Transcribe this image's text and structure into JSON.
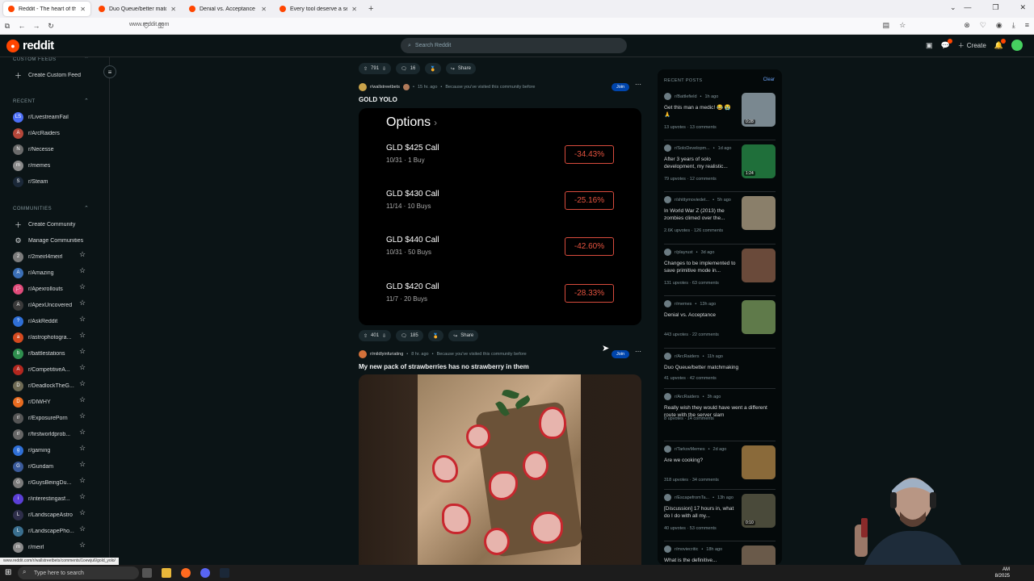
{
  "browser": {
    "tabs": [
      {
        "title": "Reddit - The heart of the internet",
        "active": true
      },
      {
        "title": "Duo Queue/better matchmaking",
        "active": false
      },
      {
        "title": "Denial vs. Acceptance : r/memes",
        "active": false
      },
      {
        "title": "Every tool deserve a second life",
        "active": false
      }
    ],
    "url": "www.reddit.com",
    "status_url": "www.reddit.com/r/wallstreetbets/comments/1oewju6/gold_yolo/"
  },
  "header": {
    "logo": "reddit",
    "search_placeholder": "Search Reddit",
    "create_label": "Create",
    "accent_color": "#ff4500"
  },
  "sidebar": {
    "custom_feeds_head": "CUSTOM FEEDS",
    "create_custom_feed": "Create Custom Feed",
    "recent_head": "RECENT",
    "recent": [
      {
        "label": "r/LivestreamFail",
        "color": "#4c6ef5",
        "glyph": "LS"
      },
      {
        "label": "r/ArcRaiders",
        "color": "#b5473a",
        "glyph": "A"
      },
      {
        "label": "r/Necesse",
        "color": "#6b6b6b",
        "glyph": "N"
      },
      {
        "label": "r/memes",
        "color": "#8a8a8a",
        "glyph": "m"
      },
      {
        "label": "r/Steam",
        "color": "#1b2838",
        "glyph": "S"
      }
    ],
    "communities_head": "COMMUNITIES",
    "create_community": "Create Community",
    "manage_communities": "Manage Communities",
    "communities": [
      {
        "label": "r/2meirl4meirl",
        "color": "#7c7c7c",
        "glyph": "2"
      },
      {
        "label": "r/Amazing",
        "color": "#3b6fb6",
        "glyph": "A"
      },
      {
        "label": "r/Apexrollouts",
        "color": "#e04b7a",
        "glyph": "🏳"
      },
      {
        "label": "r/ApexUncovered",
        "color": "#3a3a3a",
        "glyph": "A"
      },
      {
        "label": "r/AskReddit",
        "color": "#2f6fd6",
        "glyph": "?"
      },
      {
        "label": "r/astrophotogra...",
        "color": "#d44a1f",
        "glyph": "a"
      },
      {
        "label": "r/battlestations",
        "color": "#2f8f4e",
        "glyph": "b"
      },
      {
        "label": "r/CompetitiveA...",
        "color": "#b3271f",
        "glyph": "A"
      },
      {
        "label": "r/DeadlockTheG...",
        "color": "#6e6a54",
        "glyph": "D"
      },
      {
        "label": "r/DIWHY",
        "color": "#e86b1f",
        "glyph": "D"
      },
      {
        "label": "r/ExposurePorn",
        "color": "#555555",
        "glyph": "r/"
      },
      {
        "label": "r/firstworldprob...",
        "color": "#666666",
        "glyph": "r/"
      },
      {
        "label": "r/gaming",
        "color": "#2f6fd6",
        "glyph": "g"
      },
      {
        "label": "r/Gundam",
        "color": "#3a5a9a",
        "glyph": "G"
      },
      {
        "label": "r/GuysBeingDu...",
        "color": "#7b7b7b",
        "glyph": "G"
      },
      {
        "label": "r/interestingasf...",
        "color": "#5b3fd6",
        "glyph": "i"
      },
      {
        "label": "r/LandscapeAstro",
        "color": "#2e2e4a",
        "glyph": "L"
      },
      {
        "label": "r/LandscapePho...",
        "color": "#3a6f8f",
        "glyph": "L"
      },
      {
        "label": "r/meirl",
        "color": "#8a8a8a",
        "glyph": "m"
      }
    ]
  },
  "feed": {
    "post0": {
      "votes": "791",
      "comments": "16",
      "share": "Share"
    },
    "post1": {
      "subreddit": "r/wallstreetbets",
      "time": "15 hr. ago",
      "reason": "Because you've visited this community before",
      "join": "Join",
      "title": "GOLD YOLO",
      "image_title": "Options",
      "options": [
        {
          "name": "GLD $425 Call",
          "sub": "10/31 · 1 Buy",
          "pct": "-34.43%"
        },
        {
          "name": "GLD $430 Call",
          "sub": "11/14 · 10 Buys",
          "pct": "-25.16%"
        },
        {
          "name": "GLD $440 Call",
          "sub": "10/31 · 50 Buys",
          "pct": "-42.60%"
        },
        {
          "name": "GLD $420 Call",
          "sub": "11/7 · 20 Buys",
          "pct": "-28.33%"
        }
      ],
      "votes": "401",
      "comments": "185",
      "share": "Share"
    },
    "post2": {
      "subreddit": "r/mildlyinfuriating",
      "time": "8 hr. ago",
      "reason": "Because you've visited this community before",
      "join": "Join",
      "title": "My new pack of strawberries has no strawberry in them"
    }
  },
  "recent_posts": {
    "head": "RECENT POSTS",
    "clear": "Clear",
    "items": [
      {
        "community": "r/Battlefield",
        "time": "1h ago",
        "title": "Get this man a medic! 😂 😭 🙏",
        "stats": "13 upvotes · 13 comments",
        "thumb": "#7a8890",
        "duration": "0:28"
      },
      {
        "community": "r/SoloDevelopm...",
        "time": "1d ago",
        "title": "After 3 years of solo development, my realistic...",
        "stats": "79 upvotes · 12 comments",
        "thumb": "#1f6f3a",
        "duration": "1:24"
      },
      {
        "community": "r/shittymoviedet...",
        "time": "5h ago",
        "title": "In World War Z (2013) the zombies climed over the...",
        "stats": "2.6K upvotes · 126 comments",
        "thumb": "#8a7f6a",
        "duration": ""
      },
      {
        "community": "r/playrust",
        "time": "3d ago",
        "title": "Changes to be implemented to save primitive mode in...",
        "stats": "131 upvotes · 63 comments",
        "thumb": "#6a4a3a",
        "duration": ""
      },
      {
        "community": "r/memes",
        "time": "13h ago",
        "title": "Denial vs. Acceptance",
        "stats": "443 upvotes · 22 comments",
        "thumb": "#5f7a4a",
        "duration": ""
      },
      {
        "community": "r/ArcRaiders",
        "time": "11h ago",
        "title": "Duo Queue/better matchmaking",
        "stats": "41 upvotes · 42 comments",
        "thumb": "",
        "duration": ""
      },
      {
        "community": "r/ArcRaiders",
        "time": "3h ago",
        "title": "Really wish they would have went a different route with the server slam",
        "stats": "8 upvotes · 14 comments",
        "thumb": "",
        "duration": ""
      },
      {
        "community": "r/TarkovMemes",
        "time": "2d ago",
        "title": "Are we cooking?",
        "stats": "318 upvotes · 34 comments",
        "thumb": "#8a6a3a",
        "duration": ""
      },
      {
        "community": "r/EscapefromTa...",
        "time": "13h ago",
        "title": "[Discussion] 17 hours in, what do I do with all my...",
        "stats": "40 upvotes · 53 comments",
        "thumb": "#4a4a3a",
        "duration": "0:10"
      },
      {
        "community": "r/moviecritic",
        "time": "18h ago",
        "title": "What is the definitive...",
        "stats": "",
        "thumb": "#6a5a4a",
        "duration": ""
      }
    ]
  },
  "taskbar": {
    "search_placeholder": "Type here to search",
    "time": "AM",
    "date": "8/2025"
  }
}
